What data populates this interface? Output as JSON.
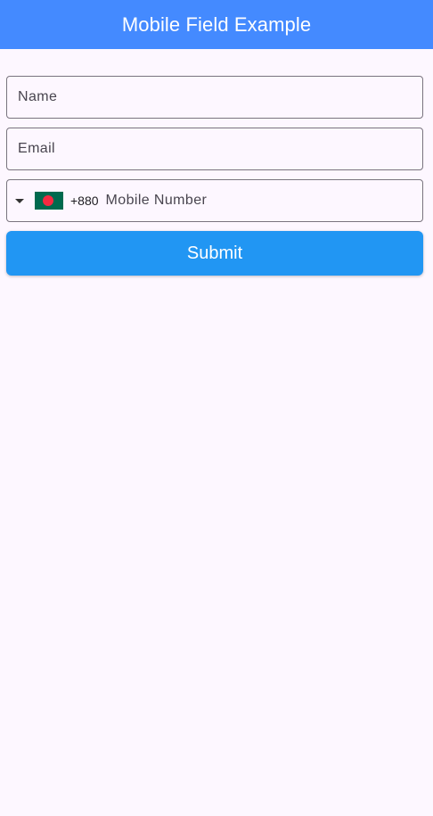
{
  "app_bar": {
    "title": "Mobile Field Example",
    "color": "#448aff"
  },
  "form": {
    "name_field": {
      "placeholder": "Name",
      "value": ""
    },
    "email_field": {
      "placeholder": "Email",
      "value": ""
    },
    "mobile_field": {
      "placeholder": "Mobile Number",
      "value": "",
      "country_flag": "bangladesh-flag-icon",
      "flag_colors": {
        "field": "#006a4e",
        "circle": "#f42a41"
      },
      "dial_code": "+880"
    },
    "submit_button": {
      "label": "Submit",
      "color": "#2196f3"
    }
  }
}
